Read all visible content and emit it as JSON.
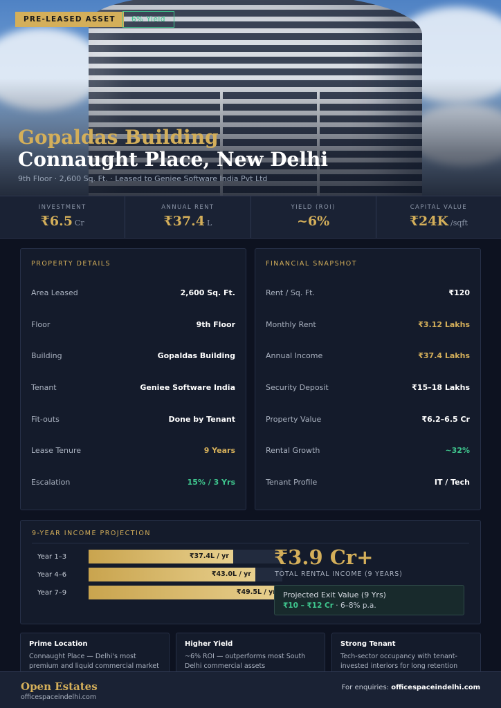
{
  "hero": {
    "badge_primary": "PRE-LEASED ASSET",
    "badge_secondary": "6% Yield",
    "title_line1": "Gopaldas Building",
    "title_line2": "Connaught Place, New Delhi",
    "subtitle": "9th Floor · 2,600 Sq. Ft. · Leased to Geniee Software India Pvt Ltd"
  },
  "stats": [
    {
      "label": "INVESTMENT",
      "value": "₹6.5",
      "unit": "Cr"
    },
    {
      "label": "ANNUAL RENT",
      "value": "₹37.4",
      "unit": "L"
    },
    {
      "label": "YIELD (ROI)",
      "value": "~6%",
      "unit": ""
    },
    {
      "label": "CAPITAL VALUE",
      "value": "₹24K",
      "unit": "/sqft"
    }
  ],
  "property_details": {
    "title": "PROPERTY DETAILS",
    "rows": [
      {
        "key": "Area Leased",
        "value": "2,600 Sq. Ft."
      },
      {
        "key": "Floor",
        "value": "9th Floor"
      },
      {
        "key": "Building",
        "value": "Gopaldas Building"
      },
      {
        "key": "Tenant",
        "value": "Geniee Software India"
      },
      {
        "key": "Fit-outs",
        "value": "Done by Tenant"
      },
      {
        "key": "Lease Tenure",
        "value": "9 Years"
      },
      {
        "key": "Escalation",
        "value": "15% / 3 Yrs"
      }
    ]
  },
  "financial_snapshot": {
    "title": "FINANCIAL SNAPSHOT",
    "rows": [
      {
        "key": "Rent / Sq. Ft.",
        "value": "₹120"
      },
      {
        "key": "Monthly Rent",
        "value": "₹3.12 Lakhs"
      },
      {
        "key": "Annual Income",
        "value": "₹37.4 Lakhs"
      },
      {
        "key": "Security Deposit",
        "value": "₹15–18 Lakhs"
      },
      {
        "key": "Property Value",
        "value": "₹6.2–6.5 Cr"
      },
      {
        "key": "Rental Growth",
        "value": "~32%"
      },
      {
        "key": "Tenant Profile",
        "value": "IT / Tech"
      }
    ]
  },
  "projection": {
    "title": "9-YEAR INCOME PROJECTION",
    "bars": [
      {
        "label": "Year 1–3",
        "value_label": "₹37.4L / yr",
        "value": 37.4
      },
      {
        "label": "Year 4–6",
        "value_label": "₹43.0L / yr",
        "value": 43.0
      },
      {
        "label": "Year 7–9",
        "value_label": "₹49.5L / yr",
        "value": 49.5
      }
    ],
    "max_value": 49.5,
    "total_value": "₹3.9 Cr+",
    "total_label": "TOTAL RENTAL INCOME (9 YEARS)",
    "exit_title": "Projected Exit Value (9 Yrs)",
    "exit_range": "₹10 – ₹12 Cr",
    "exit_rate": " · 6–8% p.a."
  },
  "features": [
    {
      "title": "Prime Location",
      "text": "Connaught Place — Delhi's most premium and liquid commercial market"
    },
    {
      "title": "Higher Yield",
      "text": "~6% ROI — outperforms most South Delhi commercial assets"
    },
    {
      "title": "Strong Tenant",
      "text": "Tech-sector occupancy with tenant-invested interiors for long retention"
    }
  ],
  "footer": {
    "brand": "Open Estates",
    "url": "officespaceindelhi.com",
    "enquiry_label": "For enquiries: ",
    "enquiry_site": "officespaceindelhi.com"
  },
  "colors": {
    "gold": "#d4af5a",
    "green": "#3fc68e",
    "background": "#0d1220",
    "panel": "#141b2b"
  }
}
